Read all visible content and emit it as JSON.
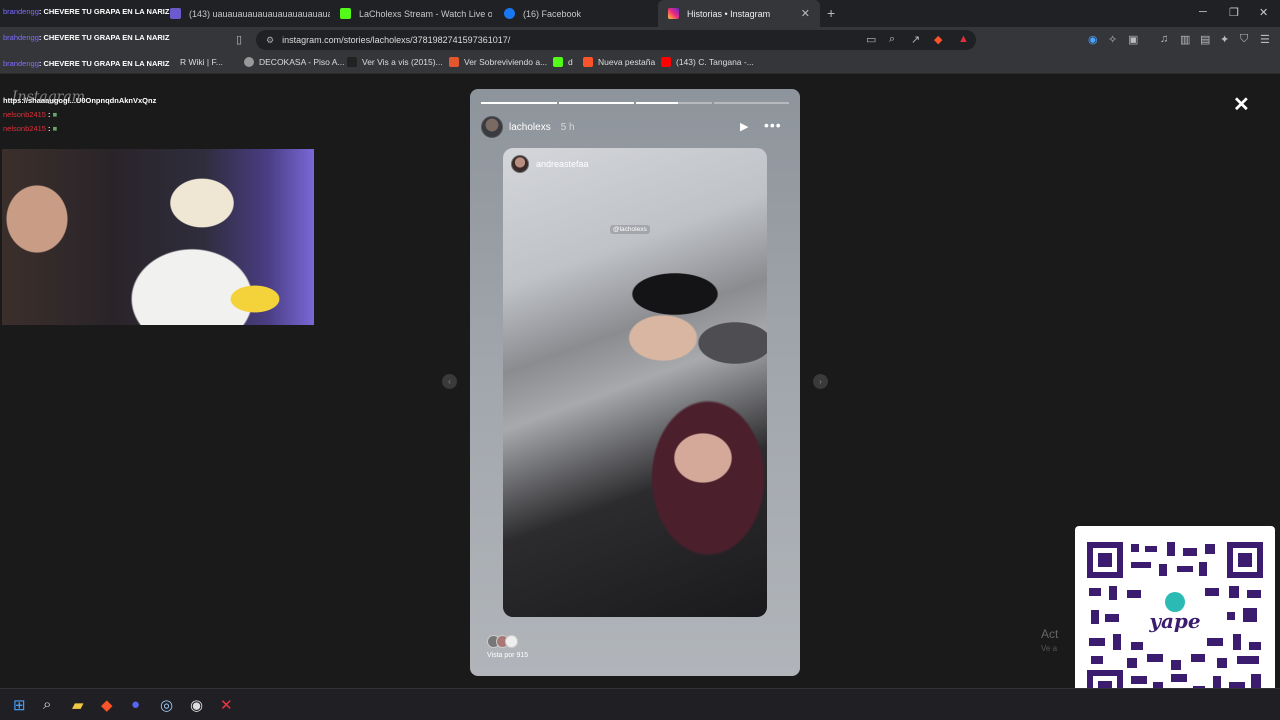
{
  "browser": {
    "tabs": [
      {
        "label": "(143) uauauauauauauauauauauauauau",
        "active": false
      },
      {
        "label": "LaCholexs Stream - Watch Live on Kick",
        "active": false
      },
      {
        "label": "(16) Facebook",
        "active": false
      },
      {
        "label": "Historias • Instagram",
        "active": true
      }
    ],
    "url": "instagram.com/stories/lacholexs/3781982741597361017/",
    "bookmarks": [
      {
        "label": "R Wiki | F..."
      },
      {
        "label": "DECOKASA - Piso A..."
      },
      {
        "label": "Ver Vis a vis (2015)..."
      },
      {
        "label": "Ver Sobreviviendo a..."
      },
      {
        "label": "d"
      },
      {
        "label": "Nueva pestaña"
      },
      {
        "label": "(143) C. Tangana -..."
      }
    ]
  },
  "story": {
    "username": "lacholexs",
    "time": "5 h",
    "progress": {
      "total_segments": 4,
      "completed": 2,
      "current_fraction": 0.55
    },
    "reshared_from": "andreastefaa",
    "mention": "@lacholexs",
    "views_label": "Vista por 915"
  },
  "chat": [
    {
      "user": "brandengg",
      "message": "CHEVERE TU GRAPA EN LA NARIZ"
    },
    {
      "user": "brahdengg",
      "message": "CHEVERE TU GRAPA EN LA NARIZ"
    },
    {
      "user": "brandengg",
      "message": "CHEVERE TU GRAPA EN LA NARIZ"
    },
    {
      "user": "",
      "message": "https://shaaaugogl...U0OnpnqdnAknVxQnz"
    },
    {
      "user": "nelsonb2415",
      "message": ""
    },
    {
      "user": "nelsonb2415",
      "message": ""
    }
  ],
  "watermark": "Instagram",
  "windows": {
    "activate_title": "Act",
    "activate_sub": "Ve a"
  },
  "colors": {
    "accent": "#7c6cff",
    "qr": "#3b1c6e"
  }
}
